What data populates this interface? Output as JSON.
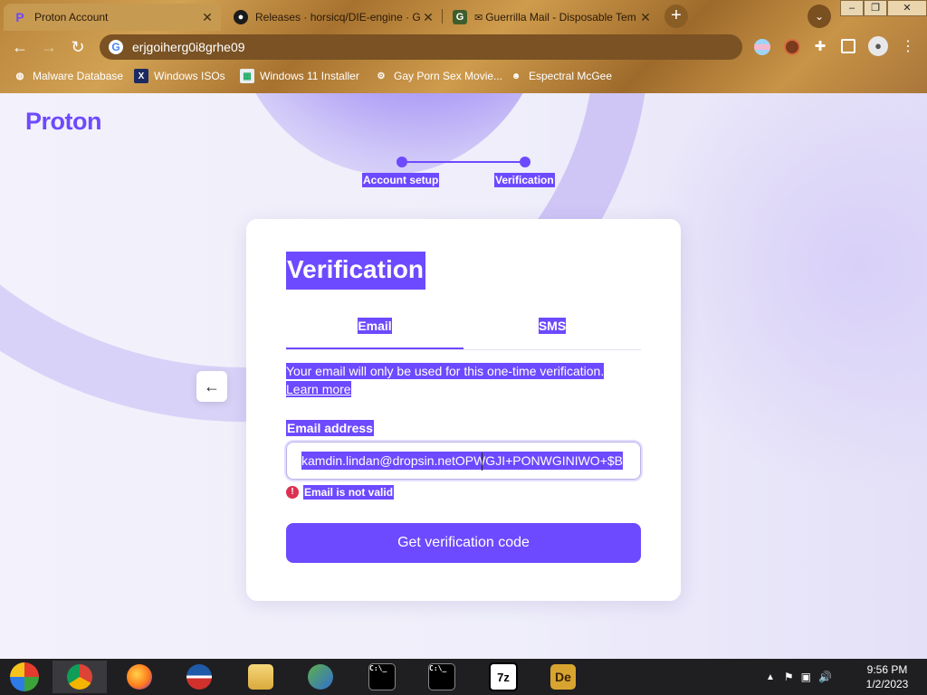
{
  "browser": {
    "tabs": [
      {
        "title": "Proton Account",
        "favicon": "P"
      },
      {
        "title": "Releases · horsicq/DIE-engine · G",
        "favicon": "github"
      },
      {
        "title": "Guerrilla Mail - Disposable Tem",
        "favicon": "G"
      }
    ],
    "new_tab": "+",
    "url": "erjgoiherg0i8grhe09",
    "window_controls": {
      "minimize": "–",
      "maximize": "❐",
      "close": "✕"
    },
    "bookmarks": [
      {
        "label": "Malware Database"
      },
      {
        "label": "Windows ISOs",
        "icon": "X"
      },
      {
        "label": "Windows 11 Installer"
      },
      {
        "label": "Gay Porn Sex Movie..."
      },
      {
        "label": "Espectral McGee"
      }
    ]
  },
  "page": {
    "logo": "Proton",
    "steps": [
      "Account setup",
      "Verification"
    ],
    "back_arrow": "←",
    "card": {
      "title": "Verification",
      "tabs": [
        "Email",
        "SMS"
      ],
      "info_text": "Your email will only be used for this one-time verification.",
      "learn_more": "Learn more",
      "email_label": "Email address",
      "email_value": "kamdin.lindan@dropsin.netOPWGJI+PONWGINIWO+$B",
      "error_icon": "!",
      "error_text": "Email is not valid",
      "submit_label": "Get verification code"
    }
  },
  "colors": {
    "accent": "#6d4aff",
    "error": "#dc3251"
  },
  "taskbar": {
    "apps": [
      {
        "name": "windows-start",
        "label": ""
      },
      {
        "name": "chrome",
        "label": ""
      },
      {
        "name": "firefox",
        "label": ""
      },
      {
        "name": "obama",
        "label": ""
      },
      {
        "name": "file-explorer",
        "label": ""
      },
      {
        "name": "network",
        "label": ""
      },
      {
        "name": "cmd-1",
        "label": "C:\\_"
      },
      {
        "name": "cmd-2",
        "label": "C:\\_"
      },
      {
        "name": "7zip",
        "label": "7z"
      },
      {
        "name": "die",
        "label": "De"
      }
    ],
    "time": "9:56 PM",
    "date": "1/2/2023"
  }
}
